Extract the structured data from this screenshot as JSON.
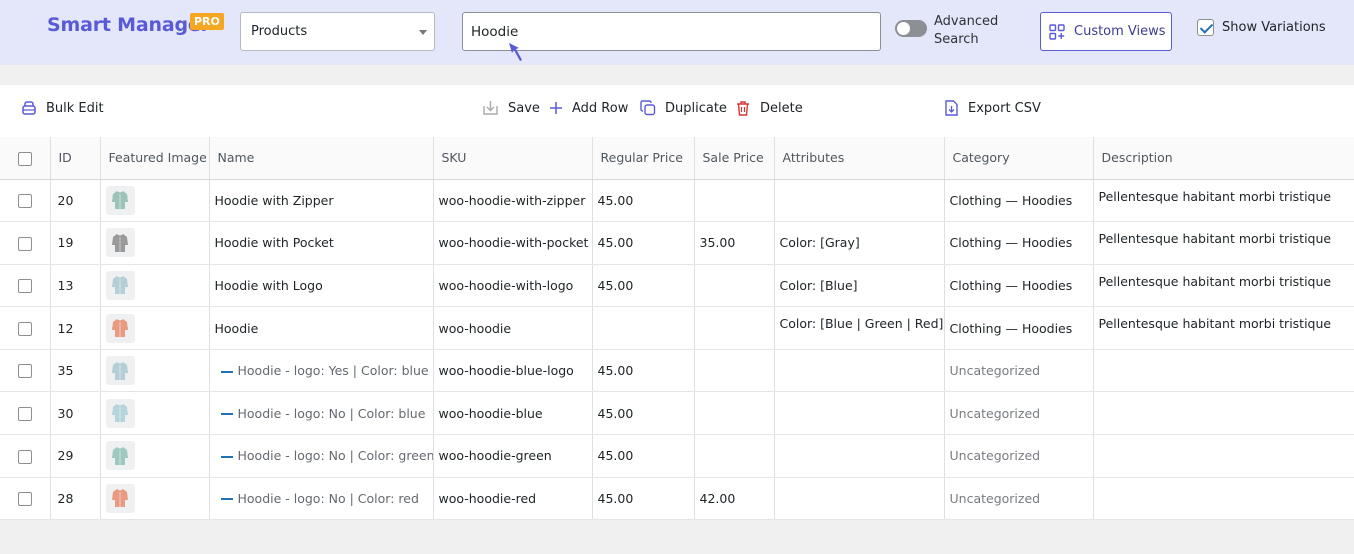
{
  "header": {
    "brand": "Smart Manager",
    "pro_badge": "PRO",
    "dashboard_select": "Products",
    "search_value": "Hoodie",
    "advanced_search_line1": "Advanced",
    "advanced_search_line2": "Search",
    "custom_views": "Custom Views",
    "show_variations": "Show Variations",
    "brand_color": "#5a5ad6",
    "accent_color": "#f5a623"
  },
  "toolbar": {
    "bulk_edit": "Bulk Edit",
    "save": "Save",
    "add_row": "Add Row",
    "duplicate": "Duplicate",
    "delete": "Delete",
    "export_csv": "Export CSV"
  },
  "columns": [
    "ID",
    "Featured Image",
    "Name",
    "SKU",
    "Regular Price",
    "Sale Price",
    "Attributes",
    "Category",
    "Description"
  ],
  "rows": [
    {
      "id": "20",
      "image": "hoodie-zipper-icon",
      "name": "Hoodie with Zipper",
      "sku": "woo-hoodie-with-zipper",
      "regular_price": "45.00",
      "sale_price": "",
      "attributes": "",
      "category": "Clothing — Hoodies",
      "description": "Pellentesque habitant morbi tristique",
      "variation": false
    },
    {
      "id": "19",
      "image": "hoodie-pocket-icon",
      "name": "Hoodie with Pocket",
      "sku": "woo-hoodie-with-pocket",
      "regular_price": "45.00",
      "sale_price": "35.00",
      "attributes": "Color: [Gray]",
      "category": "Clothing — Hoodies",
      "description": "Pellentesque habitant morbi tristique",
      "variation": false
    },
    {
      "id": "13",
      "image": "hoodie-logo-icon",
      "name": "Hoodie with Logo",
      "sku": "woo-hoodie-with-logo",
      "regular_price": "45.00",
      "sale_price": "",
      "attributes": "Color: [Blue]",
      "category": "Clothing — Hoodies",
      "description": "Pellentesque habitant morbi tristique",
      "variation": false
    },
    {
      "id": "12",
      "image": "hoodie-icon",
      "name": "Hoodie",
      "sku": "woo-hoodie",
      "regular_price": "",
      "sale_price": "",
      "attributes": "Color: [Blue | Green | Red],",
      "category": "Clothing — Hoodies",
      "description": "Pellentesque habitant morbi tristique",
      "variation": false
    },
    {
      "id": "35",
      "image": "hoodie-blue-logo-icon",
      "name": "Hoodie - logo: Yes | Color: blue",
      "sku": "woo-hoodie-blue-logo",
      "regular_price": "45.00",
      "sale_price": "",
      "attributes": "",
      "category": "Uncategorized",
      "description": "",
      "variation": true
    },
    {
      "id": "30",
      "image": "hoodie-blue-icon",
      "name": "Hoodie - logo: No | Color: blue",
      "sku": "woo-hoodie-blue",
      "regular_price": "45.00",
      "sale_price": "",
      "attributes": "",
      "category": "Uncategorized",
      "description": "",
      "variation": true
    },
    {
      "id": "29",
      "image": "hoodie-green-icon",
      "name": "Hoodie - logo: No | Color: green",
      "sku": "woo-hoodie-green",
      "regular_price": "45.00",
      "sale_price": "",
      "attributes": "",
      "category": "Uncategorized",
      "description": "",
      "variation": true
    },
    {
      "id": "28",
      "image": "hoodie-red-icon",
      "name": "Hoodie - logo: No | Color: red",
      "sku": "woo-hoodie-red",
      "regular_price": "45.00",
      "sale_price": "42.00",
      "attributes": "",
      "category": "Uncategorized",
      "description": "",
      "variation": true
    }
  ],
  "thumb_colors": [
    "#9cc4b8",
    "#9a9a9a",
    "#b5cfd6",
    "#e99b82",
    "#b5cfd6",
    "#b5d4dc",
    "#9ec8c0",
    "#e99b82"
  ]
}
